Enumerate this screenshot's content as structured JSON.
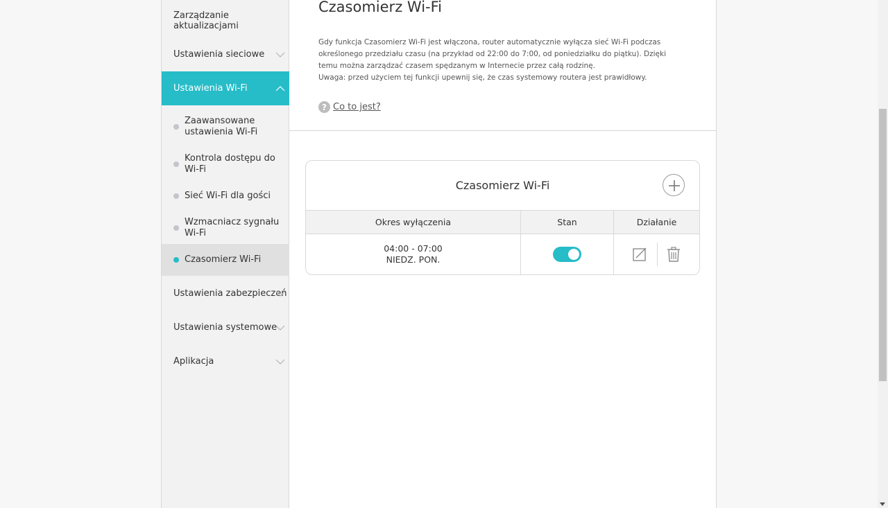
{
  "sidebar": {
    "items": [
      {
        "label": "Zarządzanie aktualizacjami"
      },
      {
        "label": "Ustawienia sieciowe"
      },
      {
        "label": "Ustawienia Wi-Fi"
      },
      {
        "label": "Ustawienia zabezpieczeń"
      },
      {
        "label": "Ustawienia systemowe"
      },
      {
        "label": "Aplikacja"
      }
    ],
    "sub_items": [
      {
        "label": "Zaawansowane ustawienia Wi-Fi"
      },
      {
        "label": "Kontrola dostępu do Wi-Fi"
      },
      {
        "label": "Sieć Wi-Fi dla gości"
      },
      {
        "label": "Wzmacniacz sygnału Wi-Fi"
      },
      {
        "label": "Czasomierz Wi-Fi"
      }
    ],
    "active_item": "Ustawienia Wi-Fi",
    "active_sub_item": "Czasomierz Wi-Fi"
  },
  "main": {
    "title": "Czasomierz Wi-Fi",
    "description_1": "Gdy funkcja Czasomierz Wi-Fi jest włączona, router automatycznie wyłącza sieć Wi-Fi podczas określonego przedziału czasu (na przykład od 22:00 do 7:00, od poniedziałku do piątku). Dzięki temu można zarządzać czasem spędzanym w Internecie przez całą rodzinę.",
    "description_2": "Uwaga: przed użyciem tej funkcji upewnij się, że czas systemowy routera jest prawidłowy.",
    "help_icon": "?",
    "help_link": "Co to jest?"
  },
  "card": {
    "title": "Czasomierz Wi-Fi",
    "columns": [
      "Okres wyłączenia",
      "Stan",
      "Działanie"
    ],
    "rows": [
      {
        "time": "04:00 - 07:00",
        "days": "NIEDZ. PON.",
        "enabled": true
      }
    ]
  },
  "colors": {
    "accent": "#26bcc8",
    "sidebar_bg": "#f2f2f2",
    "active_sub_bg": "#e0e0e0"
  },
  "icons": [
    "chevron-down-icon",
    "chevron-up-icon",
    "help-icon",
    "plus-icon",
    "edit-icon",
    "trash-icon"
  ]
}
